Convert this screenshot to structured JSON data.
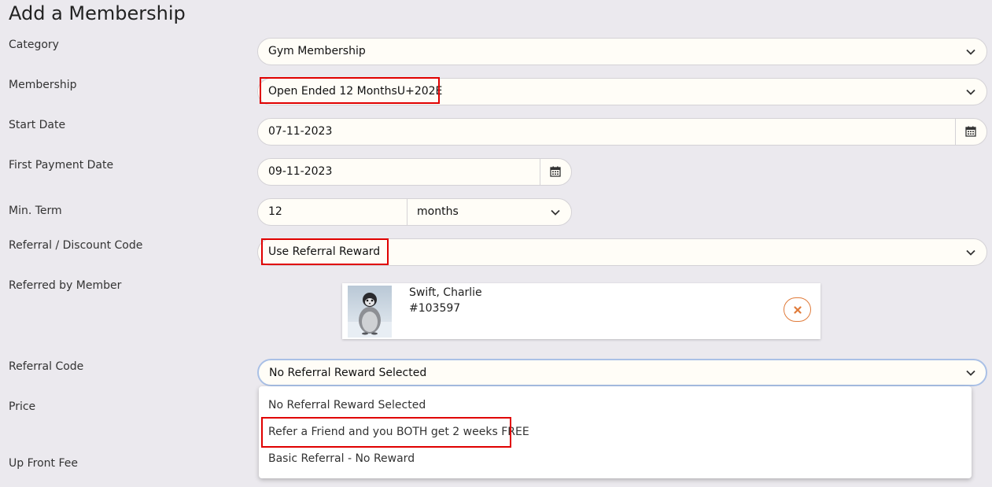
{
  "page": {
    "title": "Add a Membership"
  },
  "form": {
    "category": {
      "label": "Category",
      "value": "Gym Membership"
    },
    "membership": {
      "label": "Membership",
      "value": "Open Ended 12 MonthsU+202E"
    },
    "start_date": {
      "label": "Start Date",
      "value": "07-11-2023"
    },
    "first_payment_date": {
      "label": "First Payment Date",
      "value": "09-11-2023"
    },
    "min_term": {
      "label": "Min. Term",
      "value": "12",
      "unit": "months"
    },
    "referral_discount_code": {
      "label": "Referral / Discount Code",
      "value": "Use Referral Reward"
    },
    "referred_by": {
      "label": "Referred by Member",
      "member_name": "Swift, Charlie",
      "member_id": "#103597"
    },
    "referral_code": {
      "label": "Referral Code",
      "value": "No Referral Reward Selected",
      "options": [
        "No Referral Reward Selected",
        "Refer a Friend and you BOTH get 2 weeks FREE",
        "Basic Referral - No Reward"
      ]
    },
    "price": {
      "label": "Price"
    },
    "up_front_fee": {
      "label": "Up Front Fee"
    }
  },
  "icons": {
    "chevron": "chevron-down-icon",
    "calendar": "calendar-icon",
    "remove": "close-icon"
  },
  "colors": {
    "highlight": "#e00000",
    "remove_accent": "#e07b3a",
    "focus_border": "#a9c0e6"
  }
}
